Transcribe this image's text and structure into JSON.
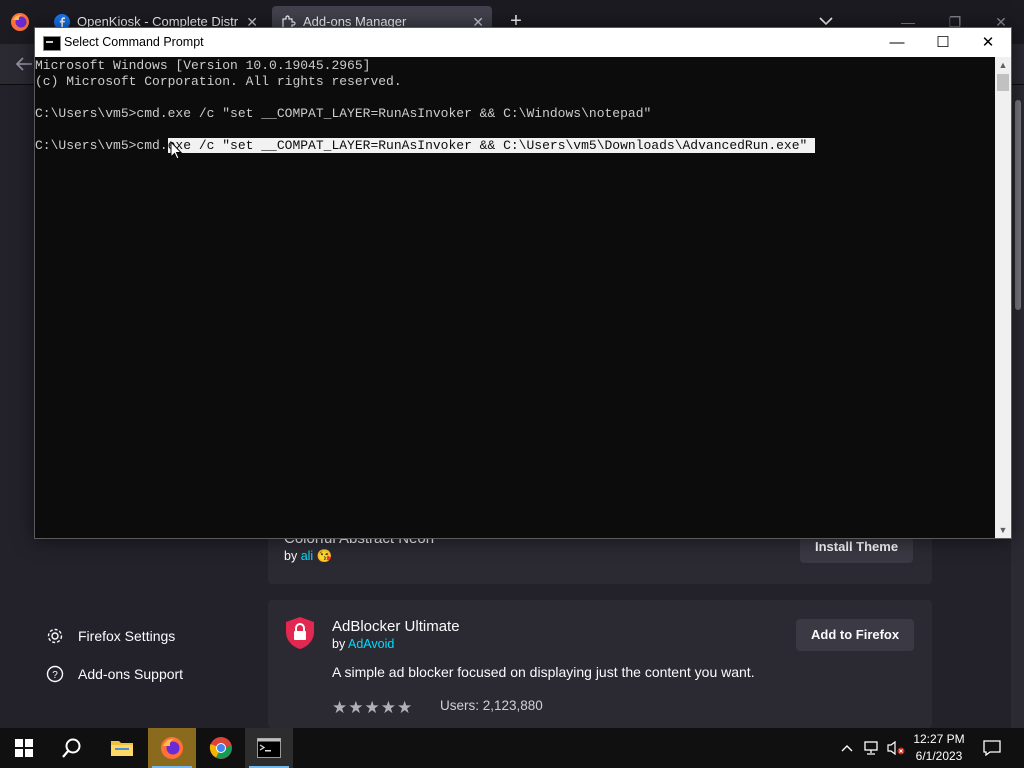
{
  "firefox": {
    "tabs": [
      {
        "title": "OpenKiosk - Complete Distribu"
      },
      {
        "title": "Add-ons Manager"
      }
    ],
    "new_tab_label": "+",
    "sidebar": {
      "settings_label": "Firefox Settings",
      "support_label": "Add-ons Support"
    },
    "theme_card": {
      "title": "Colorful Abstract Neon",
      "by": "by",
      "author": "ali",
      "button": "Install Theme"
    },
    "addon_card": {
      "title": "AdBlocker Ultimate",
      "by": "by",
      "author": "AdAvoid",
      "button": "Add to Firefox",
      "description": "A simple ad blocker focused on displaying just the content you want.",
      "rating_stars": 5,
      "users": "Users: 2,123,880"
    }
  },
  "cmd": {
    "title": "Select Command Prompt",
    "lines": {
      "l1": "Microsoft Windows [Version 10.0.19045.2965]",
      "l2": "(c) Microsoft Corporation. All rights reserved.",
      "l3": "C:\\Users\\vm5>cmd.exe /c \"set __COMPAT_LAYER=RunAsInvoker && C:\\Windows\\notepad\"",
      "l4_prefix": "C:\\Users\\vm5>cmd.",
      "l4_selected": "exe /c \"set __COMPAT_LAYER=RunAsInvoker && C:\\Users\\vm5\\Downloads\\AdvancedRun.exe\" "
    }
  },
  "taskbar": {
    "time": "12:27 PM",
    "date": "6/1/2023"
  },
  "colors": {
    "firefox_bg": "#23222b",
    "cmd_bg": "#0c0c0c",
    "cmd_text": "#cccccc",
    "accent_link": "#00ddff",
    "taskbar_bg": "#101010"
  }
}
